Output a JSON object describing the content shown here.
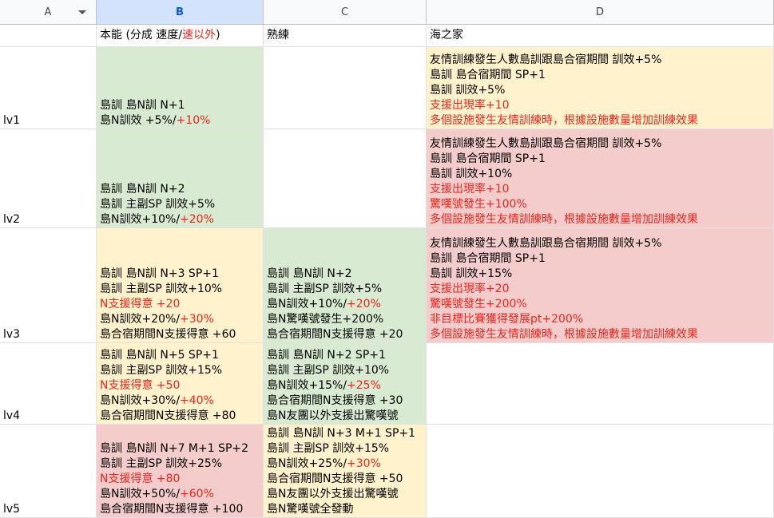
{
  "columns": [
    {
      "label": "A"
    },
    {
      "label": "B"
    },
    {
      "label": "C"
    },
    {
      "label": "D"
    }
  ],
  "header_row": {
    "a": "",
    "b": {
      "prefix": "本能 (分成 速度/",
      "red": "速以外",
      "suffix": ")"
    },
    "c": "熟練",
    "d": "海之家"
  },
  "rows": [
    {
      "label": "lv1",
      "b": {
        "lines": [
          [
            {
              "t": "島訓 島N訓 N+1"
            }
          ],
          [
            {
              "t": "島N訓效 +5%/"
            },
            {
              "t": "+10%",
              "red": true
            }
          ]
        ]
      },
      "c": {
        "lines": []
      },
      "d": {
        "lines": [
          [
            {
              "t": "友情訓練發生人數島訓跟島合宿期間 訓效+5%"
            }
          ],
          [
            {
              "t": "島訓 島合宿期間 SP+1"
            }
          ],
          [
            {
              "t": "島訓 訓效+5%"
            }
          ],
          [
            {
              "t": "支援出現率+10",
              "red": true
            }
          ],
          [
            {
              "t": "多個設施發生友情訓練時，根據設施數量增加訓練效果",
              "red": true
            }
          ]
        ]
      }
    },
    {
      "label": "lv2",
      "b": {
        "lines": [
          [
            {
              "t": "島訓 島N訓 N+2"
            }
          ],
          [
            {
              "t": "島訓 主副SP 訓效+5%"
            }
          ],
          [
            {
              "t": "島N訓效+10%/"
            },
            {
              "t": "+20%",
              "red": true
            }
          ]
        ]
      },
      "c": {
        "lines": []
      },
      "d": {
        "lines": [
          [
            {
              "t": "友情訓練發生人數島訓跟島合宿期間 訓效+5%"
            }
          ],
          [
            {
              "t": "島訓 島合宿期間 SP+1"
            }
          ],
          [
            {
              "t": "島訓 訓效+10%"
            }
          ],
          [
            {
              "t": "支援出現率+10",
              "red": true
            }
          ],
          [
            {
              "t": "驚嘆號發生+100%",
              "red": true
            }
          ],
          [
            {
              "t": "多個設施發生友情訓練時，根據設施數量增加訓練效果",
              "red": true
            }
          ]
        ]
      }
    },
    {
      "label": "lv3",
      "b": {
        "lines": [
          [
            {
              "t": "島訓 島N訓 N+3 SP+1"
            }
          ],
          [
            {
              "t": "島訓 主副SP 訓效+10%"
            }
          ],
          [
            {
              "t": "N支援得意 +20",
              "red": true
            }
          ],
          [
            {
              "t": "島N訓效+20%/"
            },
            {
              "t": "+30%",
              "red": true
            }
          ],
          [
            {
              "t": "島合宿期間N支援得意 +60"
            }
          ]
        ]
      },
      "c": {
        "lines": [
          [
            {
              "t": "島訓 島N訓 N+2"
            }
          ],
          [
            {
              "t": "島訓 主副SP 訓效+5%"
            }
          ],
          [
            {
              "t": "島N訓效+10%/"
            },
            {
              "t": "+20%",
              "red": true
            }
          ],
          [
            {
              "t": "島N驚嘆號發生+200%"
            }
          ],
          [
            {
              "t": "島合宿期間N支援得意 +20"
            }
          ]
        ]
      },
      "d": {
        "lines": [
          [
            {
              "t": "友情訓練發生人數島訓跟島合宿期間 訓效+5%"
            }
          ],
          [
            {
              "t": "島訓 島合宿期間 SP+1"
            }
          ],
          [
            {
              "t": "島訓 訓效+15%"
            }
          ],
          [
            {
              "t": "支援出現率+20",
              "red": true
            }
          ],
          [
            {
              "t": "驚嘆號發生+200%",
              "red": true
            }
          ],
          [
            {
              "t": "非目標比賽獲得發展pt+200%",
              "red": true
            }
          ],
          [
            {
              "t": "多個設施發生友情訓練時，根據設施數量增加訓練效果",
              "red": true
            }
          ]
        ]
      }
    },
    {
      "label": "lv4",
      "b": {
        "lines": [
          [
            {
              "t": "島訓 島N訓 N+5 SP+1"
            }
          ],
          [
            {
              "t": "島訓 主副SP 訓效+15%"
            }
          ],
          [
            {
              "t": "N支援得意 +50",
              "red": true
            }
          ],
          [
            {
              "t": "島N訓效+30%/"
            },
            {
              "t": "+40%",
              "red": true
            }
          ],
          [
            {
              "t": "島合宿期間N支援得意 +80"
            }
          ]
        ]
      },
      "c": {
        "lines": [
          [
            {
              "t": "島訓 島N訓 N+2 SP+1"
            }
          ],
          [
            {
              "t": "島訓 主副SP 訓效+10%"
            }
          ],
          [
            {
              "t": "島N訓效+15%/"
            },
            {
              "t": "+25%",
              "red": true
            }
          ],
          [
            {
              "t": "島合宿期間N支援得意 +30"
            }
          ],
          [
            {
              "t": "島N友團以外支援出驚嘆號"
            }
          ]
        ]
      },
      "d": {
        "lines": []
      }
    },
    {
      "label": "lv5",
      "b": {
        "lines": [
          [
            {
              "t": "島訓 島N訓 N+7 M+1  SP+2"
            }
          ],
          [
            {
              "t": "島訓 主副SP 訓效+25%"
            }
          ],
          [
            {
              "t": "N支援得意 +80",
              "red": true
            }
          ],
          [
            {
              "t": "島N訓效+50%/"
            },
            {
              "t": "+60%",
              "red": true
            }
          ],
          [
            {
              "t": "島合宿期間N支援得意 +100"
            }
          ]
        ]
      },
      "c": {
        "lines": [
          [
            {
              "t": "島訓 島N訓 N+3 M+1 SP+1"
            }
          ],
          [
            {
              "t": "島訓 主副SP 訓效+15%"
            }
          ],
          [
            {
              "t": "島N訓效+25%/"
            },
            {
              "t": "+30%",
              "red": true
            }
          ],
          [
            {
              "t": "島合宿期間N支援得意 +50"
            }
          ],
          [
            {
              "t": "島N友團以外支援出驚嘆號"
            }
          ],
          [
            {
              "t": "島N驚嘆號全發動"
            }
          ]
        ]
      },
      "d": {
        "lines": []
      }
    }
  ],
  "colors": {
    "green": "#d9ead3",
    "yellow": "#fff2cc",
    "red_fill": "#f4cccc",
    "red_text": "#e8261d",
    "selected_header": "#d3e3fd"
  }
}
